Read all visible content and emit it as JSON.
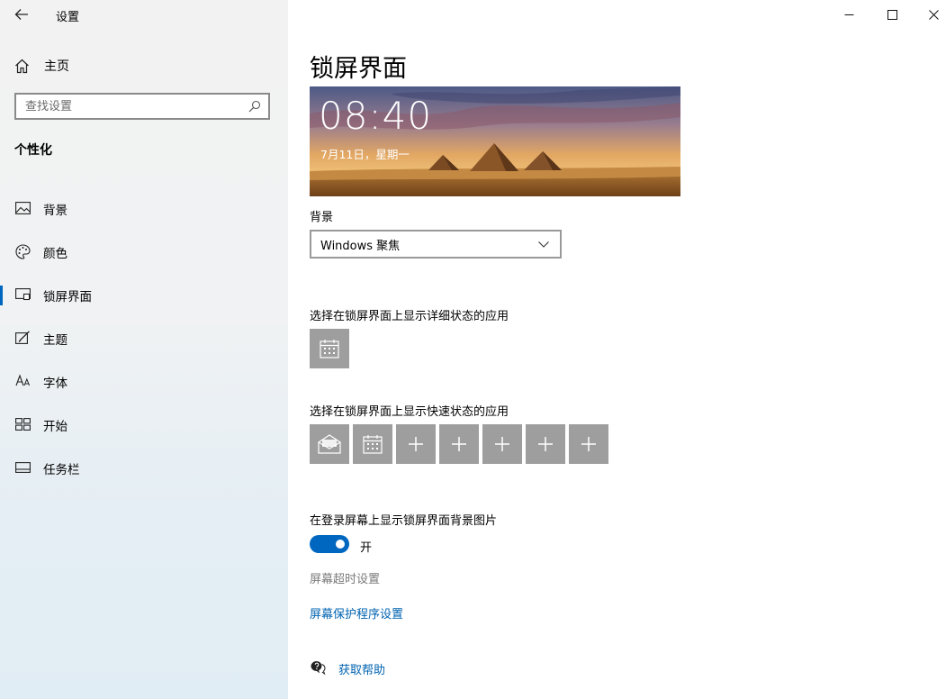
{
  "window": {
    "title": "设置",
    "controls": [
      "minimize",
      "maximize",
      "close"
    ]
  },
  "sidebar": {
    "home_label": "主页",
    "search": {
      "placeholder": "查找设置"
    },
    "section_title": "个性化",
    "items": [
      {
        "label": "背景",
        "icon": "picture-icon",
        "active": false
      },
      {
        "label": "颜色",
        "icon": "palette-icon",
        "active": false
      },
      {
        "label": "锁屏界面",
        "icon": "lock-screen-icon",
        "active": true
      },
      {
        "label": "主题",
        "icon": "theme-brush-icon",
        "active": false
      },
      {
        "label": "字体",
        "icon": "font-icon",
        "active": false
      },
      {
        "label": "开始",
        "icon": "start-tiles-icon",
        "active": false
      },
      {
        "label": "任务栏",
        "icon": "taskbar-icon",
        "active": false
      }
    ]
  },
  "main": {
    "page_title": "锁屏界面",
    "preview": {
      "time": "08:40",
      "date": "7月11日，星期一"
    },
    "background": {
      "label": "背景",
      "selected": "Windows 聚焦"
    },
    "detailed_status": {
      "label": "选择在锁屏界面上显示详细状态的应用",
      "apps": [
        "calendar-icon"
      ]
    },
    "quick_status": {
      "label": "选择在锁屏界面上显示快速状态的应用",
      "apps": [
        "mail-icon",
        "calendar-icon",
        "plus-icon",
        "plus-icon",
        "plus-icon",
        "plus-icon",
        "plus-icon"
      ]
    },
    "login_background": {
      "label": "在登录屏幕上显示锁屏界面背景图片",
      "toggle_state": "开",
      "on": true
    },
    "screen_timeout_link": "屏幕超时设置",
    "screensaver_link": "屏幕保护程序设置",
    "help_link": "获取帮助"
  },
  "colors": {
    "accent": "#0067c0",
    "tile": "#9e9e9e",
    "link": "#0063b1"
  }
}
